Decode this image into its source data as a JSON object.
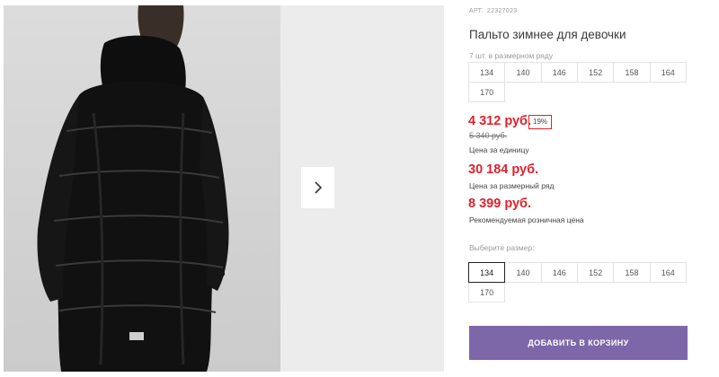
{
  "product": {
    "article_label": "Арт.",
    "article_number": "22327023",
    "title": "Пальто зимнее для девочки"
  },
  "size_row": {
    "label": "7 шт. в размерном ряду",
    "sizes": [
      "134",
      "140",
      "146",
      "152",
      "158",
      "164",
      "170"
    ]
  },
  "pricing": {
    "unit_price": "4 312 руб.",
    "discount_badge": "19%",
    "old_price": "5 340 руб.",
    "unit_caption": "Цена за единицу",
    "row_price": "30 184 руб.",
    "row_caption": "Цена за размерный ряд",
    "retail_price": "8 399 руб.",
    "retail_caption": "Рекомендуемая розничная цена"
  },
  "size_picker": {
    "label": "Выберите размер:",
    "sizes": [
      "134",
      "140",
      "146",
      "152",
      "158",
      "164",
      "170"
    ],
    "selected": "134"
  },
  "actions": {
    "add_to_cart": "ДОБАВИТЬ В КОРЗИНУ"
  },
  "colors": {
    "price": "#e0212d",
    "button": "#7e67a8"
  },
  "icons": {
    "next": "chevron-right-icon"
  }
}
